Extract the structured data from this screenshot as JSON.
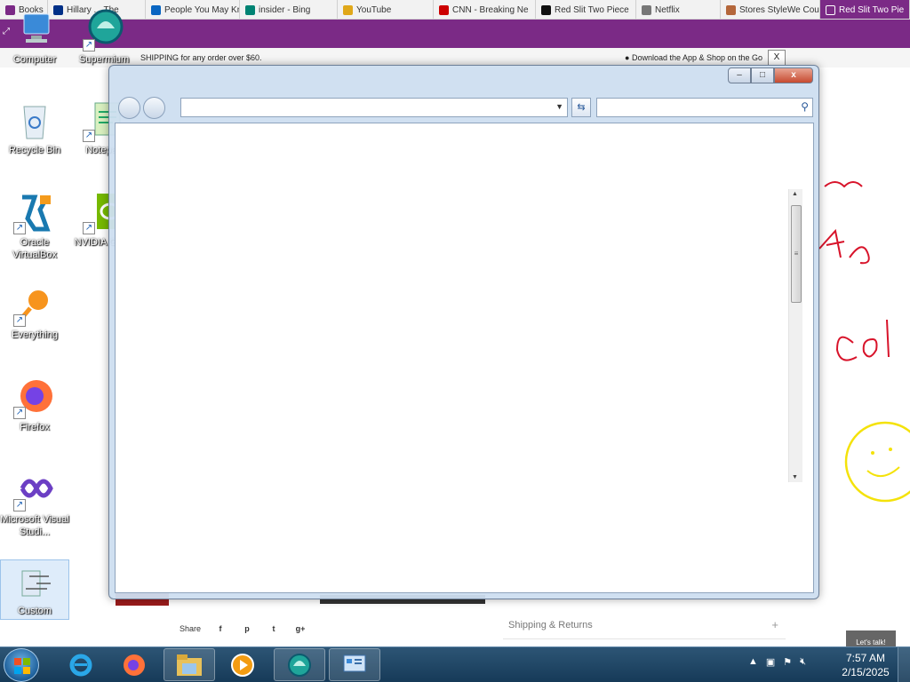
{
  "browser_tabs": [
    {
      "label": "Books",
      "icon": "bookmark-icon",
      "color": "#7b2a86"
    },
    {
      "label": "Hillary ... The",
      "icon": "paypal-icon",
      "color": "#003087"
    },
    {
      "label": "People You May Kn",
      "icon": "linkedin-icon",
      "color": "#0a66c2"
    },
    {
      "label": "insider - Bing",
      "icon": "bing-icon",
      "color": "#008373"
    },
    {
      "label": "YouTube",
      "icon": "youtube-icon",
      "color": "#e0a81a"
    },
    {
      "label": "CNN - Breaking Ne",
      "icon": "cnn-icon",
      "color": "#cc0000"
    },
    {
      "label": "Red Slit Two Piece",
      "icon": "stylewe-icon",
      "color": "#111111"
    },
    {
      "label": "Netflix",
      "icon": "netflix-icon",
      "color": "#777777"
    },
    {
      "label": "Stores StyleWe Cou",
      "icon": "store-icon",
      "color": "#b4673b"
    },
    {
      "label": "Red Slit Two Pie",
      "icon": "stylewe-icon",
      "color": "#ffffff",
      "active": true
    }
  ],
  "promo": {
    "shipping_text": "SHIPPING for any order over $60.",
    "app_text": "Download the App & Shop on the Go",
    "close_label": "X"
  },
  "desktop_icons": [
    {
      "label": "Computer",
      "icon": "computer-icon"
    },
    {
      "label": "Supermium",
      "icon": "supermium-icon"
    },
    {
      "label": "Recycle Bin",
      "icon": "recycle-bin-icon"
    },
    {
      "label": "Notepad",
      "icon": "notepad-icon"
    },
    {
      "label": "Oracle VirtualBox",
      "icon": "virtualbox-icon"
    },
    {
      "label": "NVIDIA GeFo",
      "icon": "nvidia-icon"
    },
    {
      "label": "Everything",
      "icon": "everything-icon"
    },
    {
      "label": "Firefox",
      "icon": "firefox-icon"
    },
    {
      "label": "Microsoft Visual Studi...",
      "icon": "visual-studio-icon"
    },
    {
      "label": "Custom",
      "icon": "custom-icon"
    }
  ],
  "window": {
    "min_label": "–",
    "max_label": "□",
    "close_label": "x",
    "address_value": "",
    "search_placeholder": ""
  },
  "page_bottom": {
    "share_label": "Share",
    "share_buttons": [
      "f",
      "p",
      "t",
      "g+"
    ],
    "shipping_returns": "Shipping & Returns",
    "chat_label": "Let's talk!"
  },
  "clock": {
    "time": "7:57 AM",
    "date": "2/15/2025"
  },
  "colors": {
    "brand_purple": "#7b2a86",
    "taskbar": "#1f4868"
  }
}
